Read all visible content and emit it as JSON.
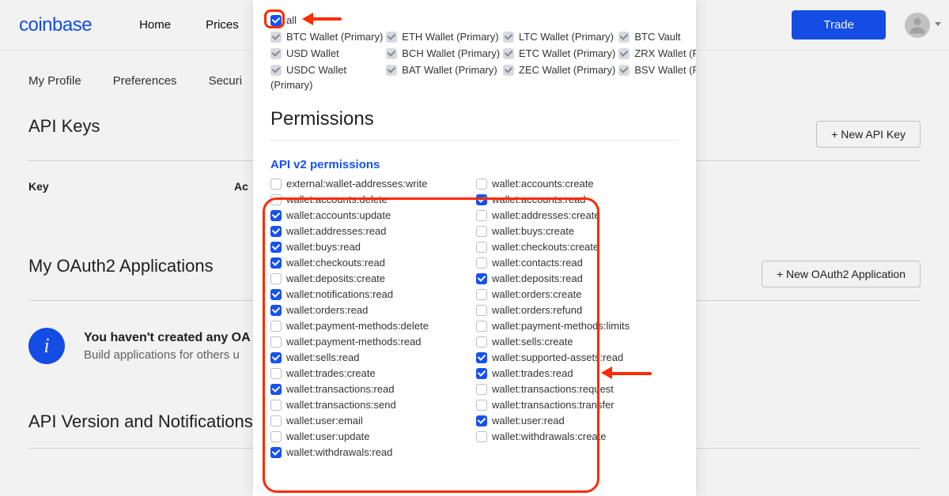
{
  "nav": {
    "logo": "coinbase",
    "links": [
      "Home",
      "Prices"
    ],
    "trade": "Trade"
  },
  "subnav": [
    "My Profile",
    "Preferences",
    "Securi"
  ],
  "bg": {
    "apiKeys": {
      "title": "API Keys",
      "newBtn": "+ New API Key",
      "col1": "Key",
      "col2": "Ac"
    },
    "oauth": {
      "title": "My OAuth2 Applications",
      "newBtn": "+ New OAuth2 Application",
      "bannerTitle": "You haven't created any OA",
      "bannerBody": "Build applications for others u"
    },
    "apiver": {
      "title": "API Version and Notifications"
    }
  },
  "modal": {
    "allLabel": "all",
    "wallets": [
      {
        "label": "BTC Wallet (Primary)",
        "on": true
      },
      {
        "label": "ETH Wallet (Primary)",
        "on": true
      },
      {
        "label": "LTC Wallet (Primary)",
        "on": true
      },
      {
        "label": "BTC Vault",
        "on": true
      },
      {
        "label": "USD Wallet",
        "on": true
      },
      {
        "label": "BCH Wallet (Primary)",
        "on": true
      },
      {
        "label": "ETC Wallet (Primary)",
        "on": true
      },
      {
        "label": "ZRX Wallet (Primary)",
        "on": true
      },
      {
        "label": "USDC Wallet",
        "on": true
      },
      {
        "label": "BAT Wallet (Primary)",
        "on": true
      },
      {
        "label": "ZEC Wallet (Primary)",
        "on": true
      },
      {
        "label": "BSV Wallet (Primary)",
        "on": true
      }
    ],
    "walletsOrphan": "(Primary)",
    "permHeading": "Permissions",
    "permSub": "API v2 permissions",
    "perms": [
      {
        "label": "external:wallet-addresses:write",
        "on": false
      },
      {
        "label": "wallet:accounts:create",
        "on": false
      },
      {
        "label": "wallet:accounts:delete",
        "on": false
      },
      {
        "label": "wallet:accounts:read",
        "on": true
      },
      {
        "label": "wallet:accounts:update",
        "on": true
      },
      {
        "label": "wallet:addresses:create",
        "on": false
      },
      {
        "label": "wallet:addresses:read",
        "on": true
      },
      {
        "label": "wallet:buys:create",
        "on": false
      },
      {
        "label": "wallet:buys:read",
        "on": true
      },
      {
        "label": "wallet:checkouts:create",
        "on": false
      },
      {
        "label": "wallet:checkouts:read",
        "on": true
      },
      {
        "label": "wallet:contacts:read",
        "on": false
      },
      {
        "label": "wallet:deposits:create",
        "on": false
      },
      {
        "label": "wallet:deposits:read",
        "on": true
      },
      {
        "label": "wallet:notifications:read",
        "on": true
      },
      {
        "label": "wallet:orders:create",
        "on": false
      },
      {
        "label": "wallet:orders:read",
        "on": true
      },
      {
        "label": "wallet:orders:refund",
        "on": false
      },
      {
        "label": "wallet:payment-methods:delete",
        "on": false
      },
      {
        "label": "wallet:payment-methods:limits",
        "on": false
      },
      {
        "label": "wallet:payment-methods:read",
        "on": false
      },
      {
        "label": "wallet:sells:create",
        "on": false
      },
      {
        "label": "wallet:sells:read",
        "on": true
      },
      {
        "label": "wallet:supported-assets:read",
        "on": true
      },
      {
        "label": "wallet:trades:create",
        "on": false
      },
      {
        "label": "wallet:trades:read",
        "on": true
      },
      {
        "label": "wallet:transactions:read",
        "on": true
      },
      {
        "label": "wallet:transactions:request",
        "on": false
      },
      {
        "label": "wallet:transactions:send",
        "on": false
      },
      {
        "label": "wallet:transactions:transfer",
        "on": false
      },
      {
        "label": "wallet:user:email",
        "on": false
      },
      {
        "label": "wallet:user:read",
        "on": true
      },
      {
        "label": "wallet:user:update",
        "on": false
      },
      {
        "label": "wallet:withdrawals:create",
        "on": false
      },
      {
        "label": "wallet:withdrawals:read",
        "on": true
      }
    ]
  }
}
